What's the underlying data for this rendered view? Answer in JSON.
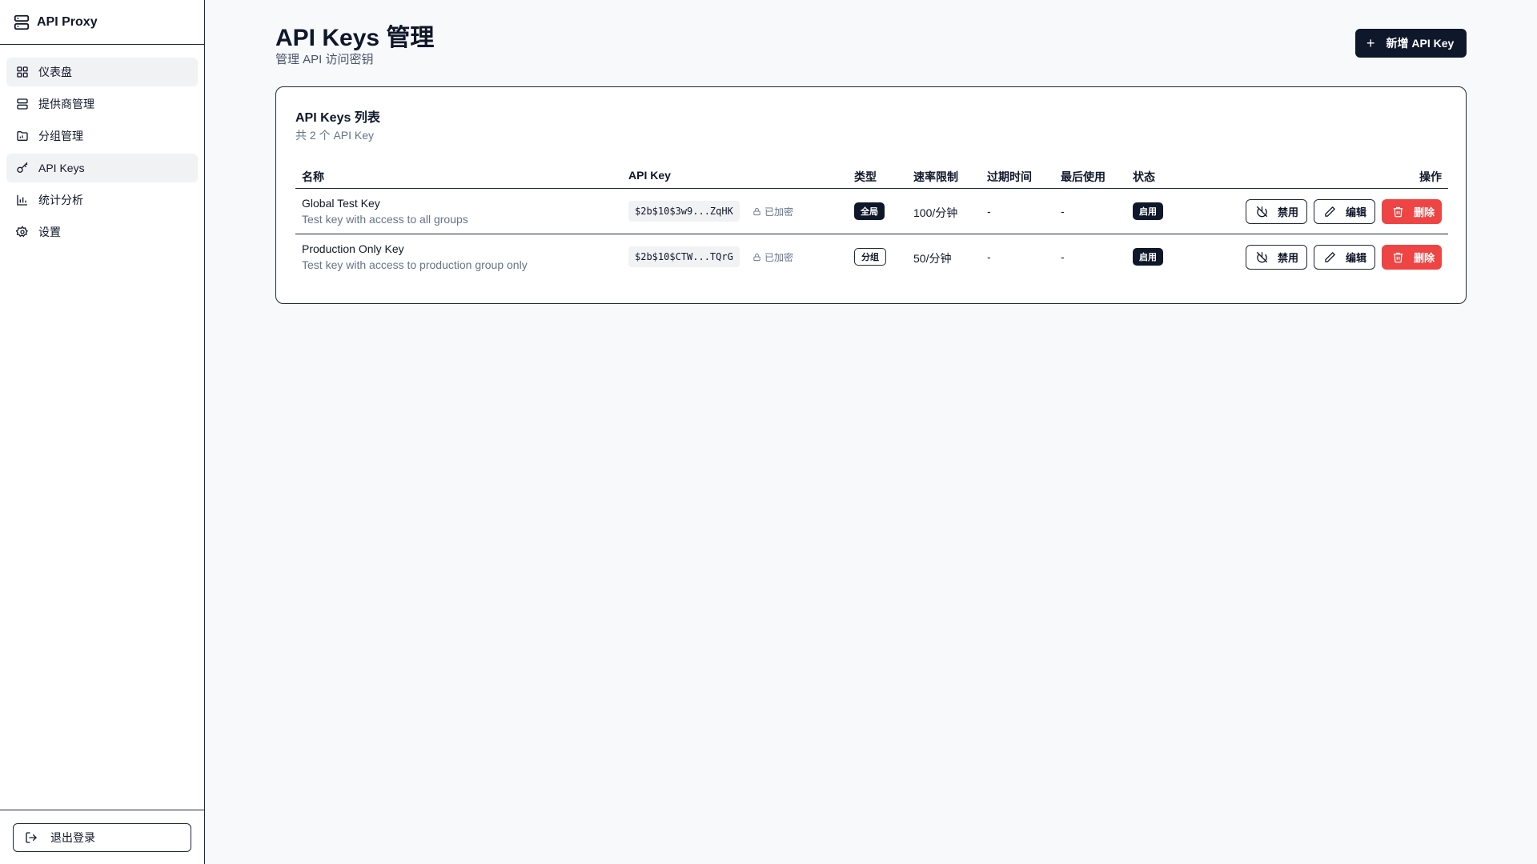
{
  "sidebar": {
    "brand": "API Proxy",
    "items": [
      {
        "label": "仪表盘",
        "icon": "dashboard-icon",
        "active": true
      },
      {
        "label": "提供商管理",
        "icon": "server-icon",
        "active": false
      },
      {
        "label": "分组管理",
        "icon": "folder-icon",
        "active": false
      },
      {
        "label": "API Keys",
        "icon": "key-icon",
        "active": true
      },
      {
        "label": "统计分析",
        "icon": "bar-chart-icon",
        "active": false
      },
      {
        "label": "设置",
        "icon": "gear-icon",
        "active": false
      }
    ],
    "logout": "退出登录"
  },
  "header": {
    "title": "API Keys 管理",
    "subtitle": "管理 API 访问密钥",
    "add_button": "新增 API Key"
  },
  "card": {
    "title": "API Keys 列表",
    "count_text": "共 2 个 API Key",
    "columns": [
      "名称",
      "API Key",
      "类型",
      "速率限制",
      "过期时间",
      "最后使用",
      "状态",
      "操作"
    ],
    "rows": [
      {
        "name": "Global Test Key",
        "description": "Test key with access to all groups",
        "key": "$2b$10$3w9...ZqHK",
        "encrypted": "已加密",
        "type": "全局",
        "rate": "100/分钟",
        "expires": "-",
        "last_used": "-",
        "status": "启用",
        "disable": "禁用",
        "edit": "编辑",
        "delete": "删除"
      },
      {
        "name": "Production Only Key",
        "description": "Test key with access to production group only",
        "key": "$2b$10$CTW...TQrG",
        "encrypted": "已加密",
        "type": "分组",
        "rate": "50/分钟",
        "expires": "-",
        "last_used": "-",
        "status": "启用",
        "disable": "禁用",
        "edit": "编辑",
        "delete": "删除"
      }
    ]
  },
  "colors": {
    "primary": "#0f172a",
    "danger": "#ef4444",
    "muted": "#64748b",
    "background": "#f8f9fb"
  }
}
